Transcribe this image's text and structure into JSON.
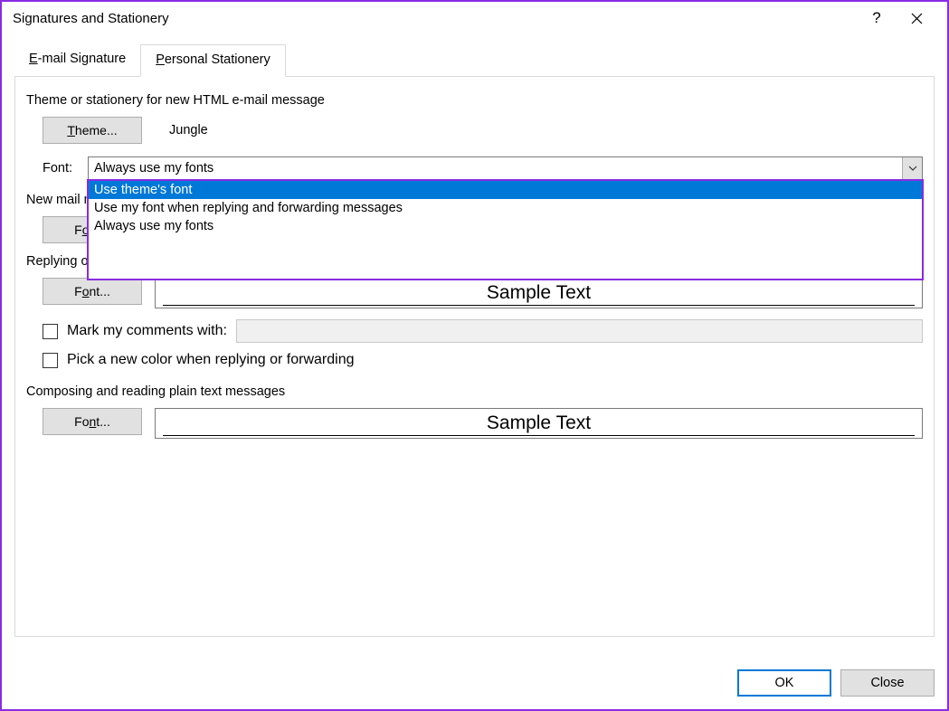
{
  "window": {
    "title": "Signatures and Stationery"
  },
  "tabs": {
    "email_signature": "E-mail Signature",
    "personal_stationery": "Personal Stationery"
  },
  "theme_section": {
    "label": "Theme or stationery for new HTML e-mail message",
    "button": "Theme...",
    "current": "Jungle"
  },
  "font_combo": {
    "label": "Font:",
    "value": "Always use my fonts",
    "options": [
      "Use theme's font",
      "Use my font when replying and forwarding messages",
      "Always use my fonts"
    ],
    "selected_index": 0
  },
  "new_mail": {
    "label": "New mail messages",
    "font_button": "Font..."
  },
  "reply": {
    "label": "Replying or forwarding messages",
    "font_button": "Font...",
    "sample": "Sample Text",
    "mark_label": "Mark my comments with:",
    "pick_color_label": "Pick a new color when replying or forwarding"
  },
  "plain": {
    "label": "Composing and reading plain text messages",
    "font_button": "Font...",
    "sample": "Sample Text"
  },
  "buttons": {
    "ok": "OK",
    "close": "Close"
  }
}
